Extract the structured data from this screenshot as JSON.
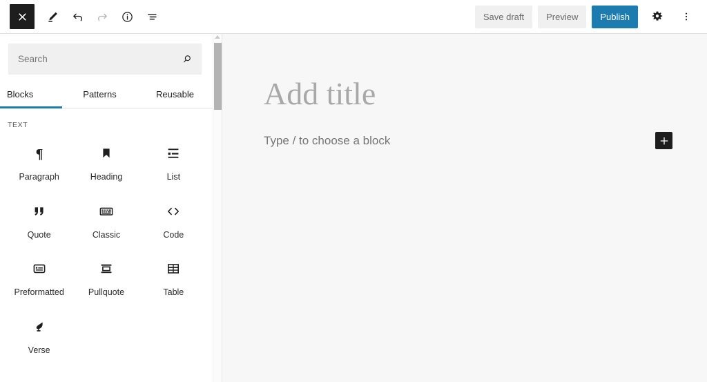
{
  "topbar": {
    "close_label": "Close editor",
    "close_icon": "close-icon",
    "edit_icon": "pencil-icon",
    "undo_icon": "undo-arrow-icon",
    "redo_icon": "redo-arrow-icon",
    "info_icon": "info-circle-icon",
    "outline_icon": "list-view-icon",
    "settings_icon": "gear-icon",
    "more_icon": "more-options-vertical-icon",
    "save_draft_label": "Save draft",
    "preview_label": "Preview",
    "publish_label": "Publish",
    "publish_color": "#1c7cb0"
  },
  "inserter": {
    "search": {
      "value": "",
      "placeholder": "Search",
      "icon": "search-icon"
    },
    "tabs": [
      {
        "label": "Blocks",
        "active": true
      },
      {
        "label": "Patterns",
        "active": false
      },
      {
        "label": "Reusable",
        "active": false
      }
    ],
    "active_tab_color": "#1c7cb0",
    "category_label": "TEXT",
    "blocks": [
      {
        "label": "Paragraph",
        "icon": "paragraph-pilcrow-icon"
      },
      {
        "label": "Heading",
        "icon": "heading-bookmark-icon"
      },
      {
        "label": "List",
        "icon": "list-bullets-icon"
      },
      {
        "label": "Quote",
        "icon": "quote-marks-icon"
      },
      {
        "label": "Classic",
        "icon": "classic-keyboard-icon"
      },
      {
        "label": "Code",
        "icon": "code-brackets-icon"
      },
      {
        "label": "Preformatted",
        "icon": "preformatted-box-icon"
      },
      {
        "label": "Pullquote",
        "icon": "pullquote-bars-icon"
      },
      {
        "label": "Table",
        "icon": "table-grid-icon"
      },
      {
        "label": "Verse",
        "icon": "verse-feather-icon"
      }
    ]
  },
  "scrollbar": {
    "up_arrow_icon": "scroll-up-arrow-icon",
    "thumb_name": "scrollbar-thumb"
  },
  "canvas": {
    "title_placeholder": "Add title",
    "block_placeholder": "Type / to choose a block",
    "add_block_icon": "plus-icon"
  }
}
